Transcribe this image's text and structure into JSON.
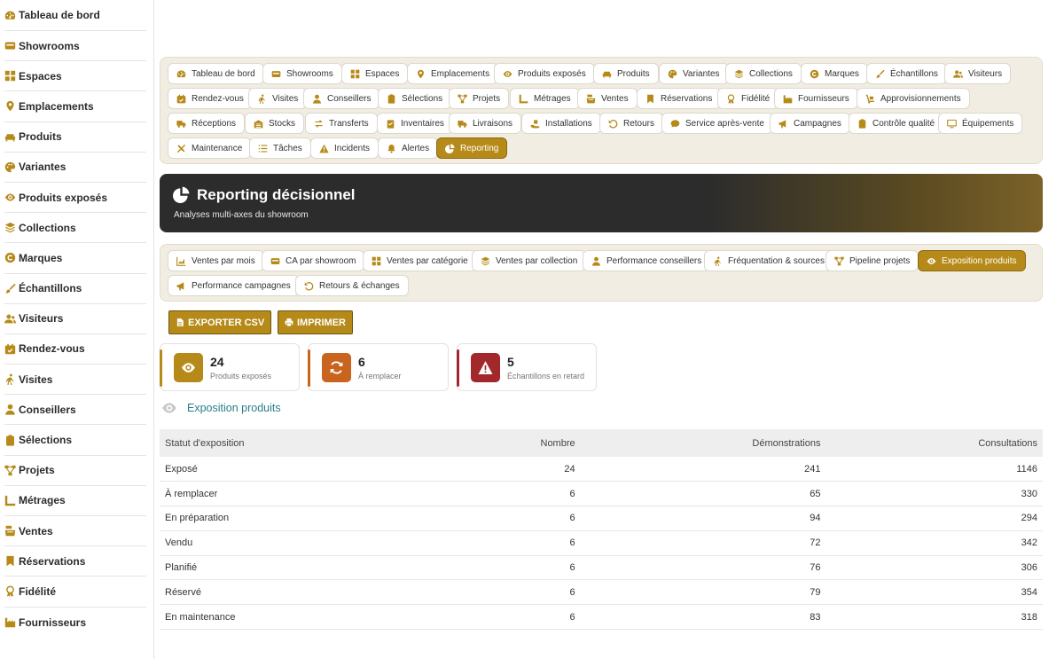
{
  "sidebar": {
    "items": [
      {
        "label": "Tableau de bord",
        "icon": "gauge-icon"
      },
      {
        "label": "Showrooms",
        "icon": "store-icon"
      },
      {
        "label": "Espaces",
        "icon": "grid-icon"
      },
      {
        "label": "Emplacements",
        "icon": "map-pin-icon"
      },
      {
        "label": "Produits",
        "icon": "couch-icon"
      },
      {
        "label": "Variantes",
        "icon": "palette-icon"
      },
      {
        "label": "Produits exposés",
        "icon": "eye-icon"
      },
      {
        "label": "Collections",
        "icon": "layers-icon"
      },
      {
        "label": "Marques",
        "icon": "copyright-icon"
      },
      {
        "label": "Échantillons",
        "icon": "brush-icon"
      },
      {
        "label": "Visiteurs",
        "icon": "users-icon"
      },
      {
        "label": "Rendez-vous",
        "icon": "calendar-check-icon"
      },
      {
        "label": "Visites",
        "icon": "walking-icon"
      },
      {
        "label": "Conseillers",
        "icon": "user-tie-icon"
      },
      {
        "label": "Sélections",
        "icon": "clipboard-icon"
      },
      {
        "label": "Projets",
        "icon": "project-diagram-icon"
      },
      {
        "label": "Métrages",
        "icon": "ruler-icon"
      },
      {
        "label": "Ventes",
        "icon": "cash-register-icon"
      },
      {
        "label": "Réservations",
        "icon": "bookmark-icon"
      },
      {
        "label": "Fidélité",
        "icon": "award-icon"
      },
      {
        "label": "Fournisseurs",
        "icon": "industry-icon"
      }
    ]
  },
  "top_nav": {
    "items": [
      {
        "label": "Tableau de bord"
      },
      {
        "label": "Showrooms"
      },
      {
        "label": "Espaces"
      },
      {
        "label": "Emplacements"
      },
      {
        "label": "Produits exposés"
      },
      {
        "label": "Produits"
      },
      {
        "label": "Variantes"
      },
      {
        "label": "Collections"
      },
      {
        "label": "Marques"
      },
      {
        "label": "Échantillons"
      },
      {
        "label": "Visiteurs"
      },
      {
        "label": "Rendez-vous"
      },
      {
        "label": "Visites"
      },
      {
        "label": "Conseillers"
      },
      {
        "label": "Sélections"
      },
      {
        "label": "Projets"
      },
      {
        "label": "Métrages"
      },
      {
        "label": "Ventes"
      },
      {
        "label": "Réservations"
      },
      {
        "label": "Fidélité"
      },
      {
        "label": "Fournisseurs"
      },
      {
        "label": "Approvisionnements"
      },
      {
        "label": "Réceptions"
      },
      {
        "label": "Stocks"
      },
      {
        "label": "Transferts"
      },
      {
        "label": "Inventaires"
      },
      {
        "label": "Livraisons"
      },
      {
        "label": "Installations"
      },
      {
        "label": "Retours"
      },
      {
        "label": "Service après-vente"
      },
      {
        "label": "Campagnes"
      },
      {
        "label": "Contrôle qualité"
      },
      {
        "label": "Équipements"
      },
      {
        "label": "Maintenance"
      },
      {
        "label": "Tâches"
      },
      {
        "label": "Incidents"
      },
      {
        "label": "Alertes"
      },
      {
        "label": "Reporting"
      }
    ],
    "active": "Reporting"
  },
  "banner": {
    "title": "Reporting décisionnel",
    "subtitle": "Analyses multi-axes du showroom"
  },
  "report_tabs": {
    "items": [
      {
        "label": "Ventes par mois"
      },
      {
        "label": "CA par showroom"
      },
      {
        "label": "Ventes par catégorie"
      },
      {
        "label": "Ventes par collection"
      },
      {
        "label": "Performance conseillers"
      },
      {
        "label": "Fréquentation & sources"
      },
      {
        "label": "Pipeline projets"
      },
      {
        "label": "Exposition produits"
      },
      {
        "label": "Performance campagnes"
      },
      {
        "label": "Retours & échanges"
      }
    ],
    "active": "Exposition produits"
  },
  "actions": {
    "export_label": "EXPORTER CSV",
    "print_label": "IMPRIMER"
  },
  "kpis": [
    {
      "value": "24",
      "label": "Produits exposés",
      "color": "#b68a19"
    },
    {
      "value": "6",
      "label": "À remplacer",
      "color": "#c8641e"
    },
    {
      "value": "5",
      "label": "Échantillons en retard",
      "color": "#a3282c"
    }
  ],
  "section": {
    "title": "Exposition produits"
  },
  "table": {
    "columns": [
      "Statut d'exposition",
      "Nombre",
      "Démonstrations",
      "Consultations"
    ],
    "rows": [
      [
        "Exposé",
        "24",
        "241",
        "1146"
      ],
      [
        "À remplacer",
        "6",
        "65",
        "330"
      ],
      [
        "En préparation",
        "6",
        "94",
        "294"
      ],
      [
        "Vendu",
        "6",
        "72",
        "342"
      ],
      [
        "Planifié",
        "6",
        "76",
        "306"
      ],
      [
        "Réservé",
        "6",
        "79",
        "354"
      ],
      [
        "En maintenance",
        "6",
        "83",
        "318"
      ]
    ]
  },
  "colors": {
    "accent": "#b68a19",
    "panel_bg": "#f2ede2",
    "banner_dark": "#2c2c2c",
    "teal_heading": "#2a7f86"
  }
}
